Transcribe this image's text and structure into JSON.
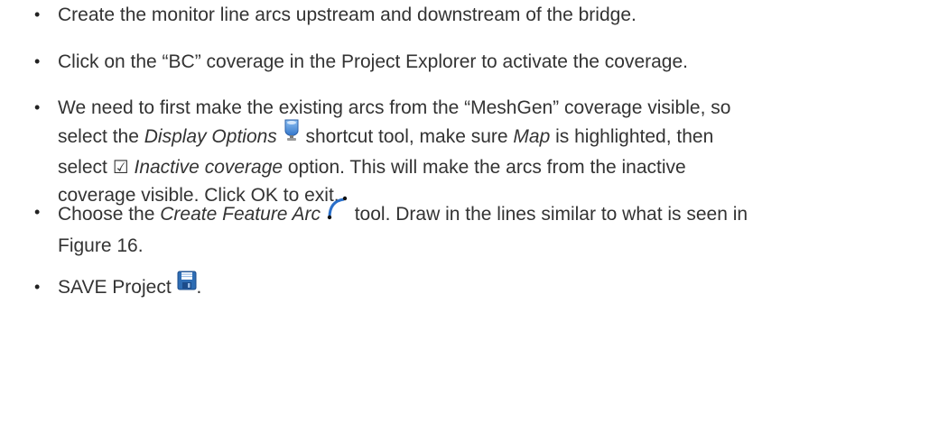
{
  "bullet_char": "•",
  "items": [
    {
      "text": "Create the monitor line arcs upstream and downstream of the bridge."
    },
    {
      "text": "Click on the “BC” coverage in the Project Explorer to activate the coverage."
    },
    {
      "line1": "We need to first make the existing arcs from the “MeshGen” coverage visible, so",
      "line2_a": "select the ",
      "line2_em1": "Display Options",
      "line2_b": " shortcut tool, make sure ",
      "line2_em2": "Map",
      "line2_c": " is highlighted, then",
      "line3_a": "select ",
      "line3_check": "☑",
      "line3_em": "Inactive coverage",
      "line3_b": " option. This will make the arcs from the inactive",
      "line4": "coverage visible. Click OK to exit."
    },
    {
      "line1_a": "Choose the ",
      "line1_em": "Create Feature Arc",
      "line1_b": " tool. Draw in the lines similar to what is seen in",
      "line2": "Figure 16."
    },
    {
      "text_a": "SAVE Project",
      "text_b": "."
    }
  ],
  "icons": {
    "display_options": "display-options-icon",
    "create_feature_arc": "create-feature-arc-icon",
    "save": "save-icon"
  },
  "colors": {
    "text": "#333333",
    "display_icon_blue": "#3b7fd4",
    "arc_icon_blue": "#2a6fc9",
    "save_icon_blue": "#2e6db4"
  }
}
